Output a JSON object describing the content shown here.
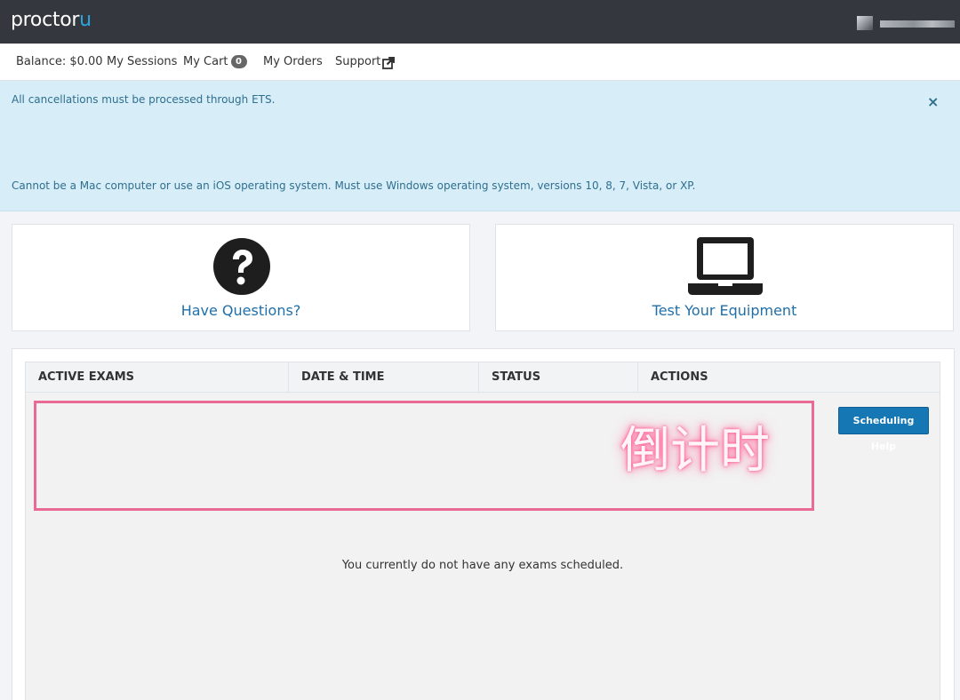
{
  "header": {
    "logo_text": "proctor",
    "logo_accent": "u",
    "brand_color": "#2aa6df",
    "user_avatar_icon": "user-avatar-icon"
  },
  "nav": {
    "balance": "Balance: $0.00",
    "sessions": "My Sessions",
    "cart": "My Cart",
    "cart_count": "0",
    "orders": "My Orders",
    "support": "Support",
    "support_icon": "external-link-icon"
  },
  "alert": {
    "line1": "All cancellations must be processed through ETS.",
    "line2": "Cannot be a Mac computer or use an iOS operating system. Must use Windows operating system, versions 10, 8, 7, Vista, or XP.",
    "close": "×",
    "close_icon": "close-icon"
  },
  "cards": {
    "questions": {
      "label": "Have Questions?",
      "icon": "question-circle-icon"
    },
    "equipment": {
      "label": "Test Your Equipment",
      "icon": "laptop-icon"
    }
  },
  "table": {
    "headers": [
      "ACTIVE EXAMS",
      "DATE & TIME",
      "STATUS",
      "ACTIONS"
    ],
    "scheduling_help": "Scheduling Help",
    "empty_message": "You currently do not have any exams scheduled."
  },
  "annotation": {
    "text": "倒计时",
    "color": "#e96b95"
  }
}
